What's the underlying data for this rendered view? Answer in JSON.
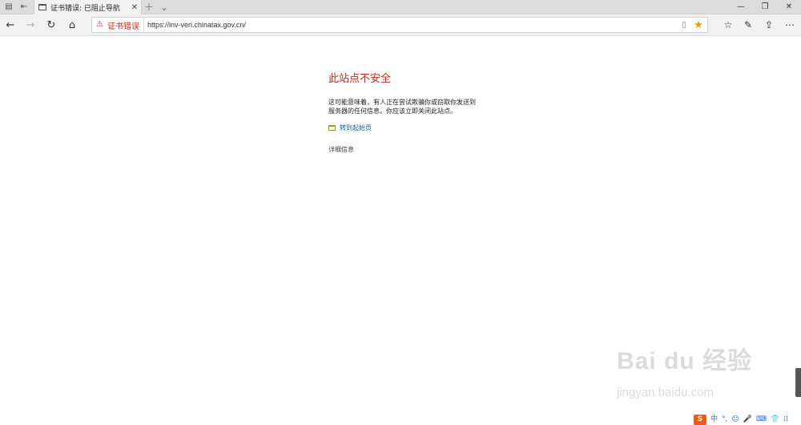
{
  "tab": {
    "title": "证书错误: 已阻止导航",
    "close_glyph": "✕"
  },
  "window_controls": {
    "minimize": "—",
    "restore": "❐",
    "close": "✕"
  },
  "address_bar": {
    "warning_label": "证书错误",
    "url": "https://inv-veri.chinatax.gov.cn/"
  },
  "error_page": {
    "title": "此站点不安全",
    "description": "这可能意味着，有人正在尝试欺骗你或窃取你发送到服务器的任何信息。你应该立即关闭此站点。",
    "home_link": "转到起始页",
    "details_link": "详细信息"
  },
  "watermark": {
    "logo": "Bai du 经验",
    "url": "jingyan.baidu.com"
  },
  "ime": {
    "logo": "S",
    "mode": "中",
    "items": [
      "°,",
      "☺",
      "🎤",
      "⌨",
      "👕",
      "⁞⁞"
    ]
  },
  "colors": {
    "error_red": "#c42b1c",
    "link_blue": "#0063b1",
    "favorite_star": "#e5a000",
    "ime_orange": "#ef5a14"
  }
}
